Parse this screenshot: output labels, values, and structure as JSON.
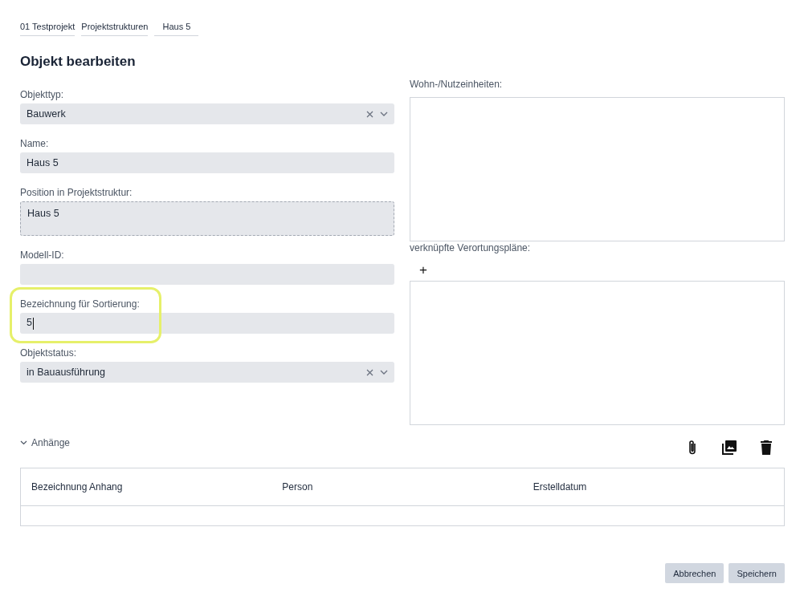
{
  "breadcrumbs": [
    "01 Testprojekt",
    "Projektstrukturen",
    "Haus 5"
  ],
  "title": "Objekt bearbeiten",
  "fields": [
    {
      "kind": "select",
      "label": "Objekttyp:",
      "value": "Bauwerk",
      "highlighted": false,
      "focused": false
    },
    {
      "kind": "text",
      "label": "Name:",
      "value": "Haus 5",
      "highlighted": false,
      "focused": false
    },
    {
      "kind": "textarea",
      "label": "Position in Projektstruktur:",
      "value": "Haus 5",
      "highlighted": false,
      "focused": false
    },
    {
      "kind": "text",
      "label": "Modell-ID:",
      "highlighted": false,
      "focused": false
    },
    {
      "kind": "text",
      "label": "Bezeichnung für Sortierung:",
      "value": "5",
      "highlighted": true,
      "focused": true
    },
    {
      "kind": "select",
      "label": "Objektstatus:",
      "value": "in Bauausführung",
      "highlighted": false,
      "focused": false
    }
  ],
  "units": {
    "label": "Wohn-/Nutzeinheiten:"
  },
  "plans": {
    "label": "verknüpfte Verortungspläne:",
    "add": "+"
  },
  "attachments": {
    "label": "Anhänge",
    "expanded": true,
    "columns": [
      "Bezeichnung Anhang",
      "Person",
      "Erstelldatum"
    ]
  },
  "buttons": [
    "Abbrechen",
    "Speichern"
  ]
}
